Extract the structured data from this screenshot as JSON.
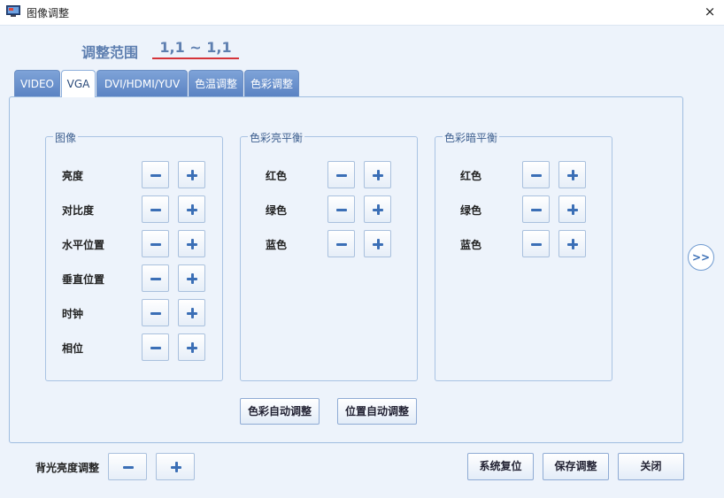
{
  "window": {
    "title": "图像调整",
    "close_glyph": "×"
  },
  "range": {
    "label": "调整范围",
    "value": "1,1 ~ 1,1"
  },
  "tabs": [
    {
      "label": "VIDEO"
    },
    {
      "label": "VGA",
      "active": true
    },
    {
      "label": "DVI/HDMI/YUV"
    },
    {
      "label": "色温调整"
    },
    {
      "label": "色彩调整"
    }
  ],
  "groups": {
    "image": {
      "title": "图像",
      "rows": [
        "亮度",
        "对比度",
        "水平位置",
        "垂直位置",
        "时钟",
        "相位"
      ]
    },
    "bright_balance": {
      "title": "色彩亮平衡",
      "rows": [
        "红色",
        "绿色",
        "蓝色"
      ]
    },
    "dark_balance": {
      "title": "色彩暗平衡",
      "rows": [
        "红色",
        "绿色",
        "蓝色"
      ]
    }
  },
  "auto_buttons": {
    "color_auto": "色彩自动调整",
    "position_auto": "位置自动调整"
  },
  "next_button": ">>",
  "backlight": {
    "label": "背光亮度调整"
  },
  "footer": {
    "reset": "系统复位",
    "save": "保存调整",
    "close": "关闭"
  },
  "colors": {
    "accent": "#5b83c3",
    "range_text": "#5e7fb0",
    "underline": "#d5343a",
    "panel_bg": "#edf3fb"
  },
  "icons": {
    "minus": "minus-icon",
    "plus": "plus-icon",
    "app": "monitor-icon",
    "close": "close-icon"
  }
}
